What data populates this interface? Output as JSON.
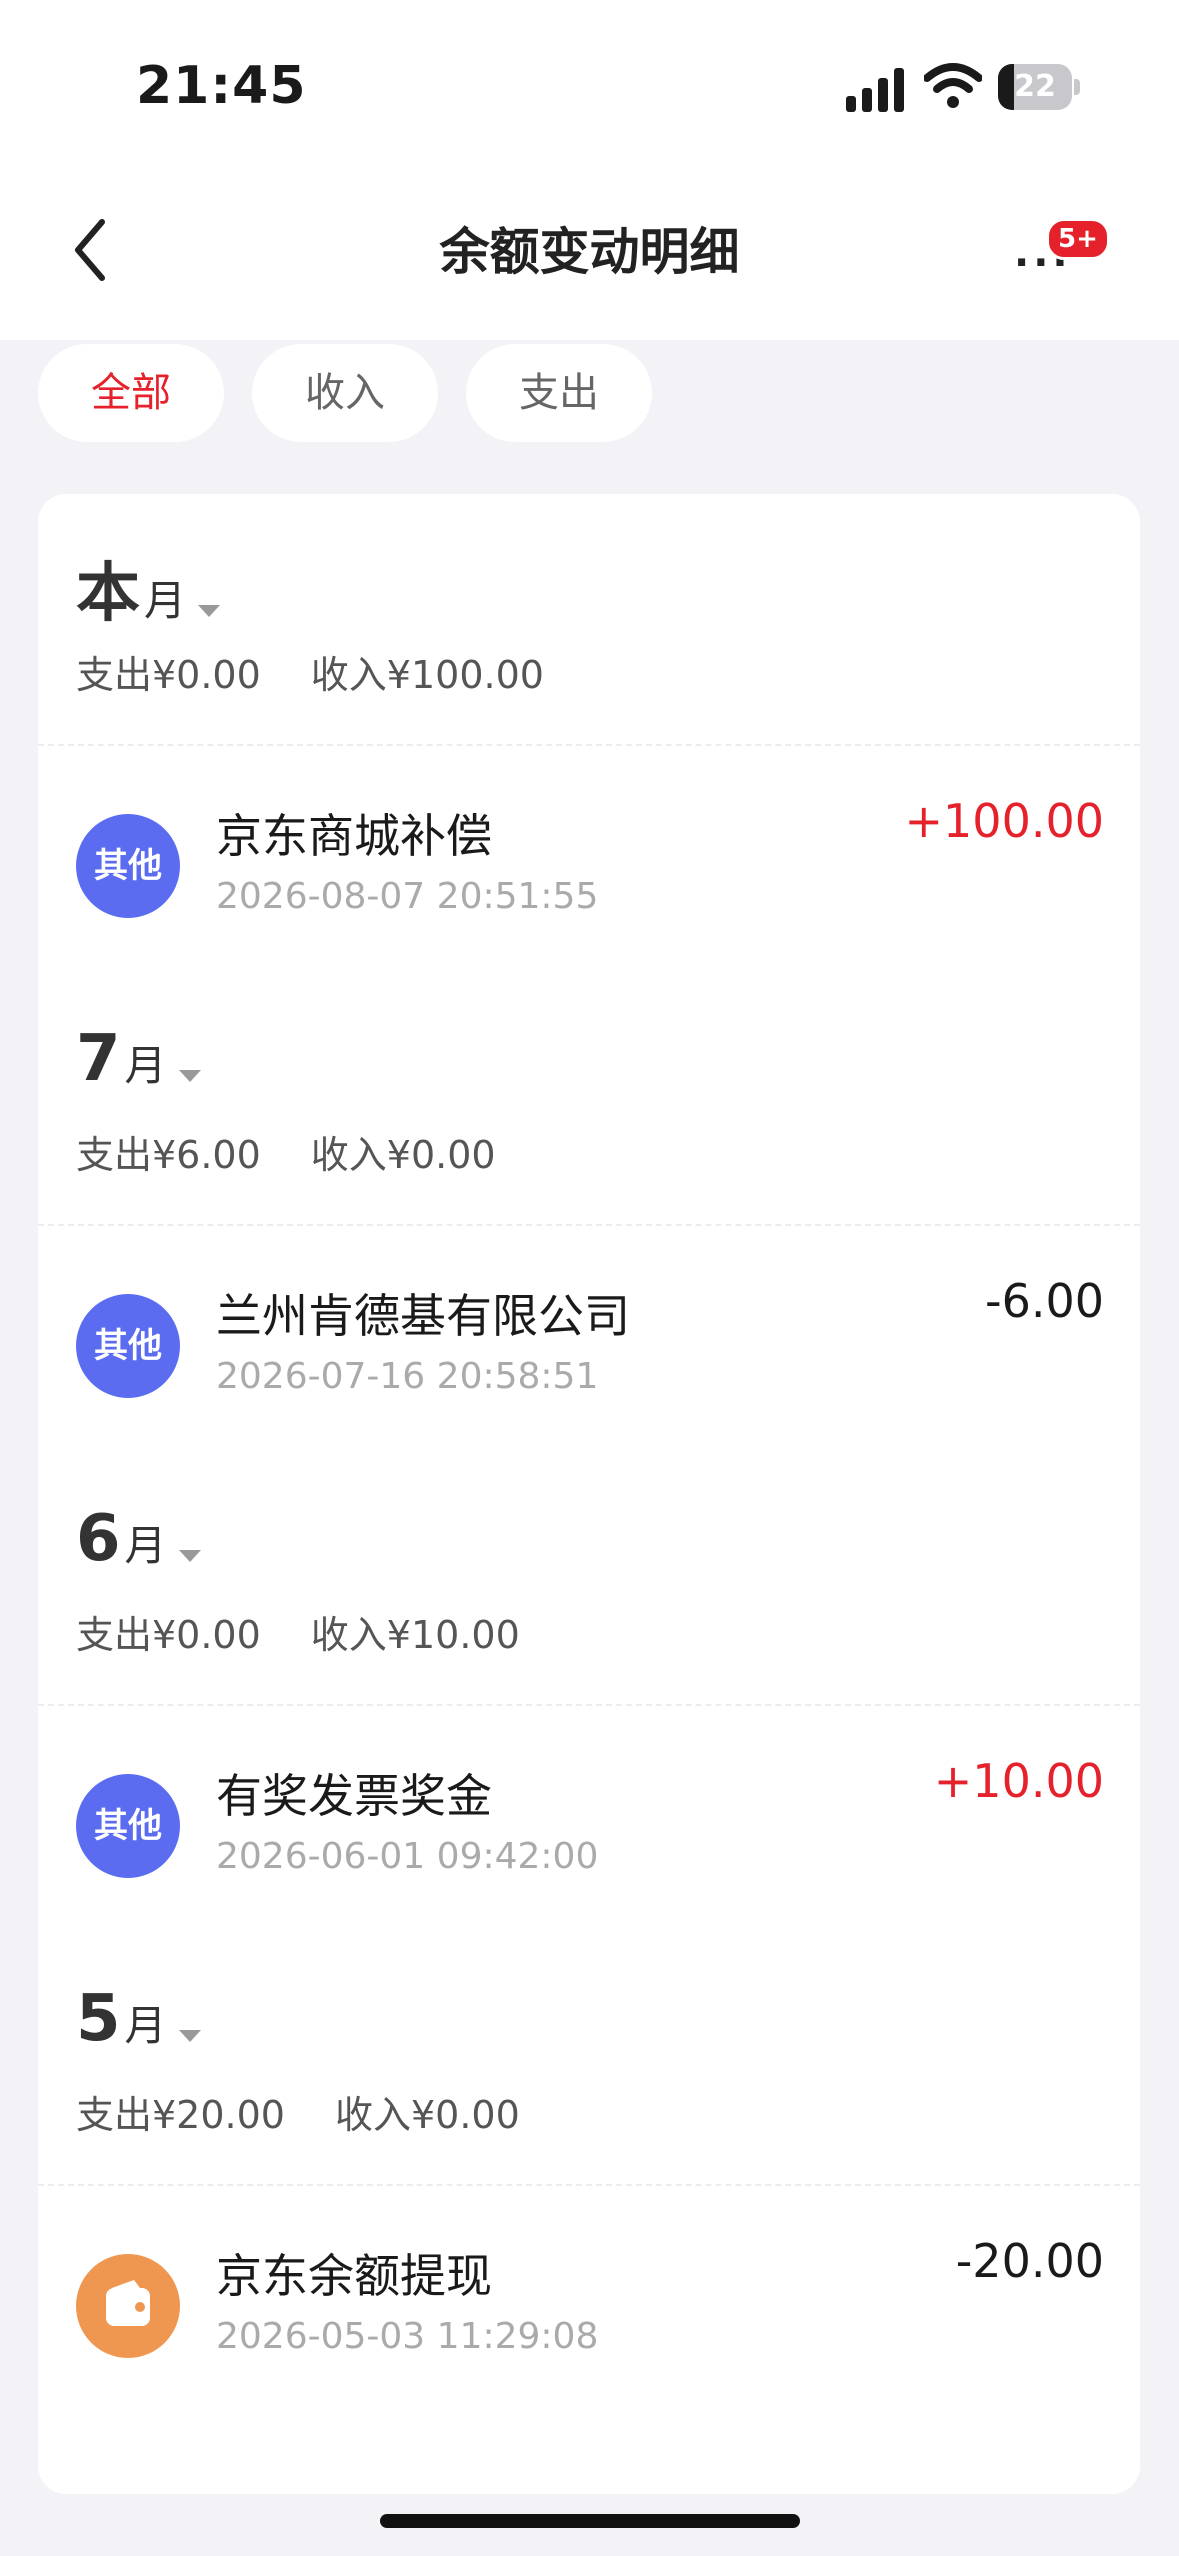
{
  "status_bar": {
    "time": "21:45",
    "battery": "22",
    "battery_level": 0.22
  },
  "nav": {
    "title": "余额变动明细",
    "badge": "5+"
  },
  "tabs": [
    {
      "label": "全部",
      "active": true
    },
    {
      "label": "收入",
      "active": false
    },
    {
      "label": "支出",
      "active": false
    }
  ],
  "groups": [
    {
      "month_big": "本",
      "month_small": "月",
      "expense": "支出¥0.00",
      "income": "收入¥100.00",
      "tx": {
        "icon_text": "其他",
        "icon_color": "#5b6cf0",
        "title": "京东商城补偿",
        "time": "2026-08-07 20:51:55",
        "amount": "+100.00"
      }
    },
    {
      "month_big": "7",
      "month_small": "月",
      "expense": "支出¥6.00",
      "income": "收入¥0.00",
      "tx": {
        "icon_text": "其他",
        "icon_color": "#5b6cf0",
        "title": "兰州肯德基有限公司",
        "time": "2026-07-16 20:58:51",
        "amount": "-6.00"
      }
    },
    {
      "month_big": "6",
      "month_small": "月",
      "expense": "支出¥0.00",
      "income": "收入¥10.00",
      "tx": {
        "icon_text": "其他",
        "icon_color": "#5b6cf0",
        "title": "有奖发票奖金",
        "time": "2026-06-01 09:42:00",
        "amount": "+10.00"
      }
    },
    {
      "month_big": "5",
      "month_small": "月",
      "expense": "支出¥20.00",
      "income": "收入¥0.00",
      "tx": {
        "icon_text": "",
        "icon_name": "wallet-icon",
        "icon_color": "#ef9650",
        "title": "京东余额提现",
        "time": "2026-05-03 11:29:08",
        "amount": "-20.00"
      }
    }
  ],
  "colors": {
    "accent": "#e5212b",
    "other_icon": "#5b6cf0",
    "wallet_icon": "#ef9650"
  }
}
